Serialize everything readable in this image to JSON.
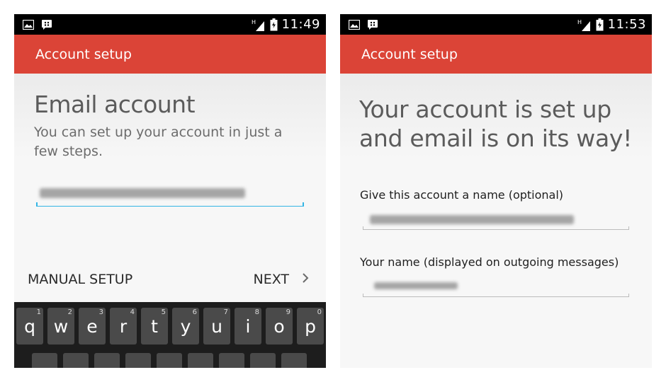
{
  "left_screen": {
    "status_time": "11:49",
    "action_title": "Account setup",
    "title": "Email account",
    "subtitle": "You can set up your account in just a few steps.",
    "email_value": "",
    "manual_setup_label": "MANUAL SETUP",
    "next_label": "NEXT",
    "keyboard_row1": [
      {
        "letter": "q",
        "hint": "1"
      },
      {
        "letter": "w",
        "hint": "2"
      },
      {
        "letter": "e",
        "hint": "3"
      },
      {
        "letter": "r",
        "hint": "4"
      },
      {
        "letter": "t",
        "hint": "5"
      },
      {
        "letter": "y",
        "hint": "6"
      },
      {
        "letter": "u",
        "hint": "7"
      },
      {
        "letter": "i",
        "hint": "8"
      },
      {
        "letter": "o",
        "hint": "9"
      },
      {
        "letter": "p",
        "hint": "0"
      }
    ]
  },
  "right_screen": {
    "status_time": "11:53",
    "action_title": "Account setup",
    "title": "Your account is set up and email is on its way!",
    "account_name_label": "Give this account a name (optional)",
    "account_name_value": "",
    "your_name_label": "Your name (displayed on outgoing messages)",
    "your_name_value": ""
  },
  "icons": {
    "gallery": "image-icon",
    "bbm": "bbm-chat-icon",
    "signal": "signal-icon",
    "battery": "battery-icon",
    "chevron": "chevron-right-icon"
  },
  "colors": {
    "action_bar": "#db4437",
    "status_bar": "#000000",
    "focus_underline": "#33b5e5",
    "keyboard_bg": "#1d1d1d",
    "key_bg": "#4a4a4a"
  }
}
